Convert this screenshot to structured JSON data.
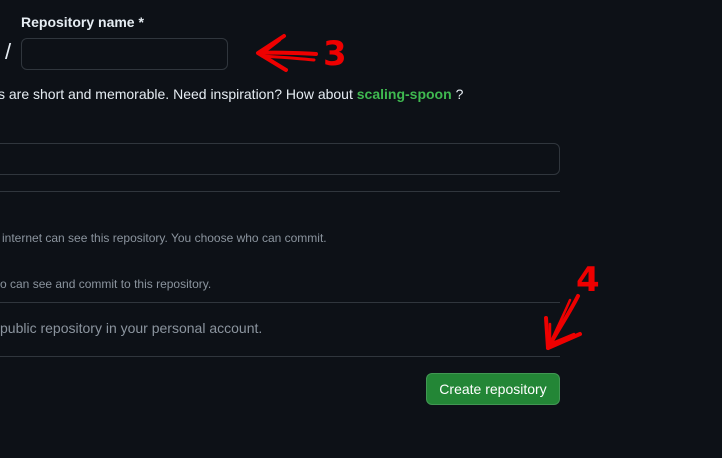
{
  "form": {
    "repo_name_label": "Repository name *",
    "owner_separator": "/",
    "repo_name_value": "",
    "hint_prefix": "s are short and memorable. Need inspiration? How about",
    "hint_suggestion": "scaling-spoon",
    "hint_suffix": "?",
    "description_value": "",
    "public_desc": "internet can see this repository. You choose who can commit.",
    "private_desc": "o can see and commit to this repository.",
    "info_text": "public repository in your personal account.",
    "create_button_label": "Create repository"
  },
  "annotations": {
    "step_repo_name": "3",
    "step_create": "4",
    "color": "#ee0000"
  },
  "theme": {
    "background": "#0d1117",
    "border": "#30363d",
    "accent_green": "#3fb950",
    "button_green": "#238636"
  }
}
